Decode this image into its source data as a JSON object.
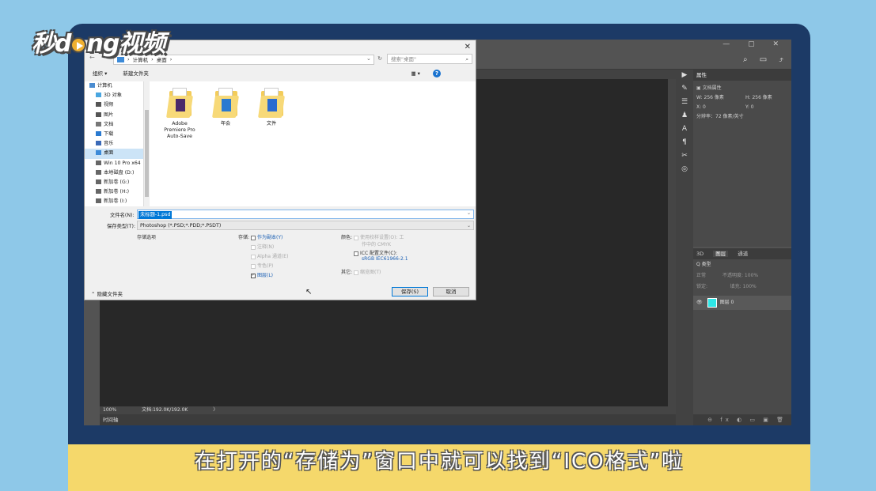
{
  "logo": {
    "part1": "秒d",
    "part2": "ng视频"
  },
  "subtitle": "在打开的“存储为”窗口中就可以找到“ICO格式”啦",
  "photoshop": {
    "window_controls": "— ▢ ✕",
    "status_zoom": "100%",
    "status_doc": "文档:192.0K/192.0K",
    "status_arrow": "〉",
    "timeline": "时间轴",
    "properties": {
      "header": "属性",
      "doc_title": "文档属性",
      "w": "W:  256 像素",
      "h": "H:  256 像素",
      "x": "X:  0",
      "y": "Y:  0",
      "resolution": "分辨率：72 像素/英寸"
    },
    "layers": {
      "tab_3d": "3D",
      "tab_layers": "图层",
      "tab_channels": "通道",
      "filter": "Q 类型",
      "blend": "正常",
      "opacity": "不透明度: 100%",
      "lock": "锁定:",
      "fill": "填充: 100%",
      "layer_name": "图层 0",
      "eye": "👁",
      "thumb_color": "#2ee6e6"
    }
  },
  "dialog": {
    "close": "✕",
    "nav_buttons": "← → ↑",
    "path_computer": "计算机",
    "path_desktop": "桌面",
    "search_placeholder": "搜索\"桌面\"",
    "organize": "组织 ▾",
    "new_folder": "新建文件夹",
    "view": "▦ ▾",
    "help": "?",
    "nav_items": [
      {
        "label": "计算机",
        "color": "#4a8cd0"
      },
      {
        "label": "3D 对象",
        "color": "#4aa6e0"
      },
      {
        "label": "视频",
        "color": "#555555"
      },
      {
        "label": "图片",
        "color": "#555555"
      },
      {
        "label": "文档",
        "color": "#777777"
      },
      {
        "label": "下载",
        "color": "#2a7ad0"
      },
      {
        "label": "音乐",
        "color": "#3a6ab8"
      },
      {
        "label": "桌面",
        "color": "#3c8ad8"
      },
      {
        "label": "Win 10 Pro x64",
        "color": "#666666"
      },
      {
        "label": "本地磁盘 (D:)",
        "color": "#666666"
      },
      {
        "label": "新加卷 (G:)",
        "color": "#666666"
      },
      {
        "label": "新加卷 (H:)",
        "color": "#666666"
      },
      {
        "label": "新加卷 (I:)",
        "color": "#666666"
      }
    ],
    "files": [
      {
        "name": "Adobe Premiere Pro Auto-Save",
        "badge_color": "#4a2a6a"
      },
      {
        "name": "年会",
        "badge_color": "#2a7ad0"
      },
      {
        "name": "文件",
        "badge_color": "#2a6ad0"
      }
    ],
    "filename_label": "文件名(N):",
    "filename_value": "未标题-1.psd",
    "savetype_label": "保存类型(T):",
    "savetype_value": "Photoshop (*.PSD;*.PDD;*.PSDT)",
    "save_options": "存储选项",
    "store_label": "存储:",
    "as_copy": "作为副本(Y)",
    "annotations": "注释(N)",
    "alpha": "Alpha 通道(E)",
    "spot": "专色(P)",
    "layers_opt": "图层(L)",
    "color_label": "颜色:",
    "use_proof": "使用校样设置(O):  工",
    "working_cmyk": "作中的 CMYK",
    "icc": "ICC 配置文件(C):",
    "srgb": "sRGB IEC61966-2.1",
    "other_label": "其它:",
    "thumbnail": "缩览图(T)",
    "hide_folders": "隐藏文件夹",
    "save_btn": "保存(S)",
    "cancel_btn": "取消"
  }
}
